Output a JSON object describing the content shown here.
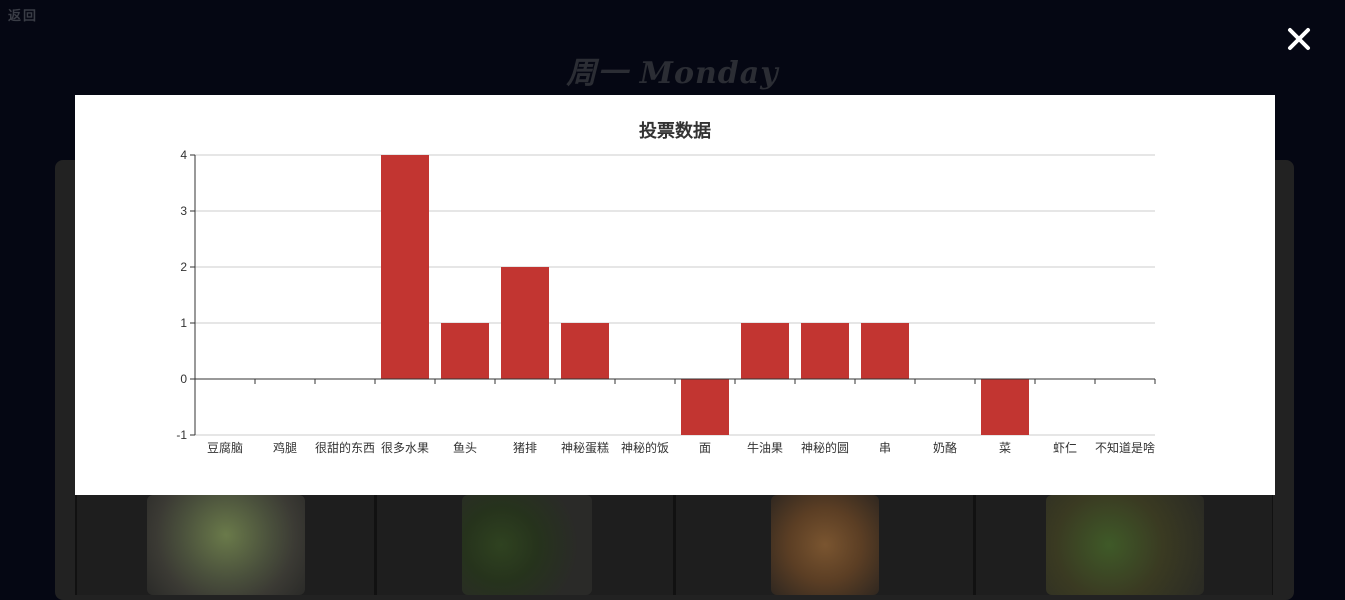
{
  "page": {
    "back_label": "返回",
    "heading": "周一 Monday"
  },
  "modal": {
    "close_icon": "close-icon"
  },
  "colors": {
    "bar": "#c23531",
    "grid": "#cccccc",
    "axis": "#333333",
    "background": "#050713"
  },
  "chart_data": {
    "type": "bar",
    "title": "投票数据",
    "categories": [
      "豆腐脑",
      "鸡腿",
      "很甜的东西",
      "很多水果",
      "鱼头",
      "猪排",
      "神秘蛋糕",
      "神秘的饭",
      "面",
      "牛油果",
      "神秘的圆",
      "串",
      "奶酪",
      "菜",
      "虾仁",
      "不知道是啥"
    ],
    "values": [
      0,
      0,
      0,
      4,
      1,
      2,
      1,
      0,
      -1,
      1,
      1,
      1,
      0,
      -1,
      0,
      0
    ],
    "ylim": [
      -1,
      4
    ],
    "yticks": [
      "-1",
      "0",
      "1",
      "2",
      "3",
      "4"
    ],
    "grid": true
  }
}
